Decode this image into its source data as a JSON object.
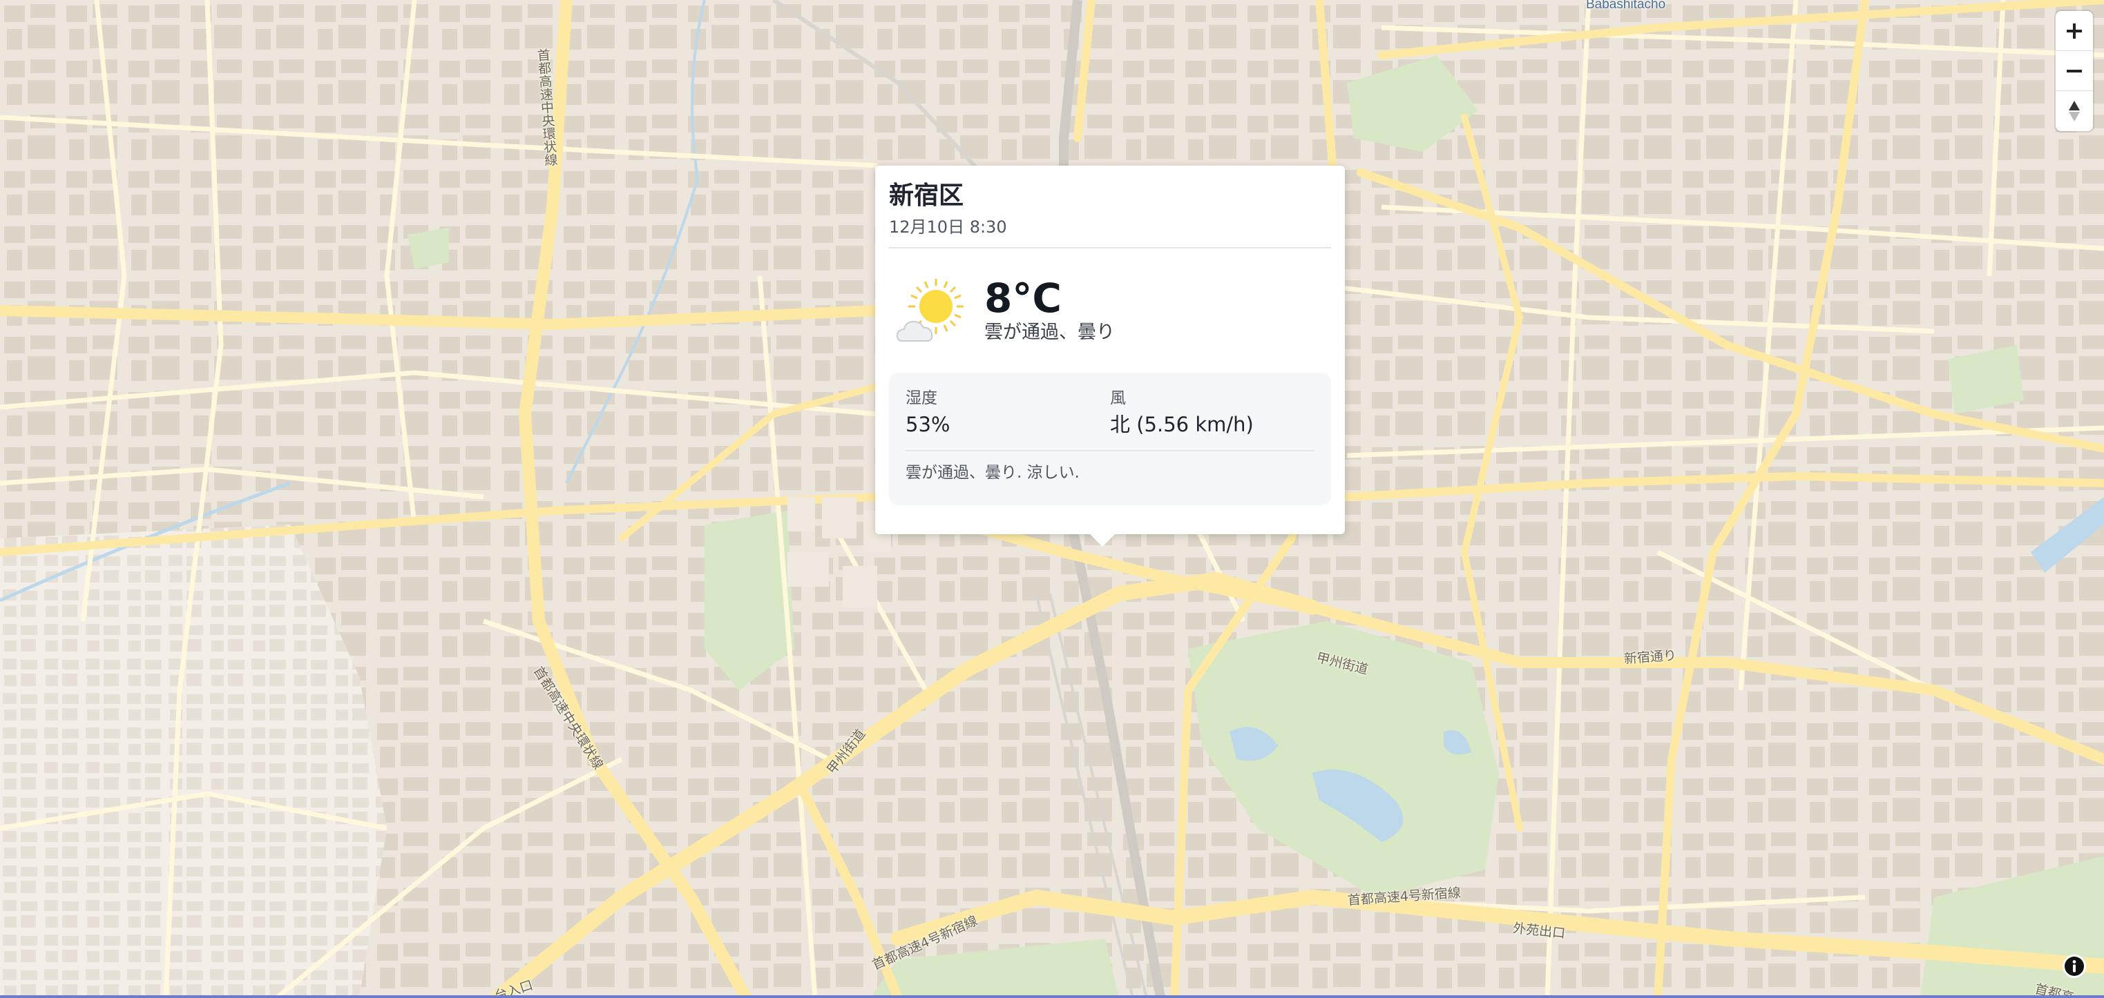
{
  "map": {
    "place_labels": [
      {
        "id": "babashitacho",
        "text": "Babashitacho"
      }
    ],
    "road_labels": [
      {
        "id": "shuto-chuo-kanjo",
        "text": "首都高速中央環状線"
      },
      {
        "id": "shuto-chuo-kanjo-2",
        "text": "首都高速中央環状線"
      },
      {
        "id": "koshu-kaido-1",
        "text": "甲州街道"
      },
      {
        "id": "koshu-kaido-2",
        "text": "甲州街道"
      },
      {
        "id": "shinjuku-dori",
        "text": "新宿通り"
      },
      {
        "id": "shuto-4-1",
        "text": "首都高速4号新宿線"
      },
      {
        "id": "shuto-4-2",
        "text": "首都高速4号新宿線"
      },
      {
        "id": "gaien-exit",
        "text": "外苑出口"
      },
      {
        "id": "entrance",
        "text": "台入口"
      },
      {
        "id": "shuto-corner",
        "text": "首都高"
      }
    ],
    "colors": {
      "land": "#ece6dc",
      "building": "#ddd5c8",
      "road_major": "#fde9a4",
      "road_minor": "#fff8dc",
      "park": "#d8e8c6",
      "water": "#bcd8ea",
      "rail": "#cfcbc4"
    }
  },
  "controls": {
    "zoom_in_icon": "plus-icon",
    "zoom_out_icon": "minus-icon",
    "compass_icon": "compass-icon",
    "attribution_icon": "info-icon"
  },
  "popup": {
    "title": "新宿区",
    "date": "12月10日 8:30",
    "icon": "partly-cloudy-sun-icon",
    "temperature": "8°C",
    "condition": "雲が通過、曇り",
    "humidity_label": "湿度",
    "humidity_value": "53%",
    "wind_label": "風",
    "wind_value": "北 (5.56 km/h)",
    "description": "雲が通過、曇り. 涼しい."
  }
}
